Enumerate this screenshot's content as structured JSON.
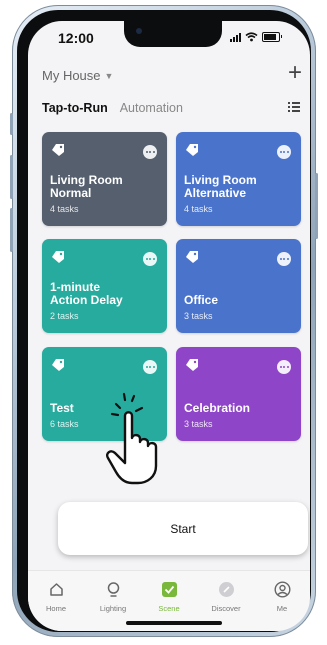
{
  "status": {
    "time": "12:00"
  },
  "header": {
    "house": "My House",
    "add_icon": "plus-icon"
  },
  "tabs": [
    {
      "label": "Tap-to-Run",
      "active": true
    },
    {
      "label": "Automation",
      "active": false
    }
  ],
  "scenes": [
    {
      "title_line1": "Living Room",
      "title_line2": "Normal",
      "tasks": "4 tasks",
      "color": "#555f6e",
      "dots": "#555f6e"
    },
    {
      "title_line1": "Living Room",
      "title_line2": "Alternative",
      "tasks": "4 tasks",
      "color": "#4a74cc",
      "dots": "#4a74cc"
    },
    {
      "title_line1": "1-minute",
      "title_line2": "Action Delay",
      "tasks": "2 tasks",
      "color": "#27ab9e",
      "dots": "#27ab9e"
    },
    {
      "title_line1": "",
      "title_line2": "Office",
      "tasks": "3 tasks",
      "color": "#4a74cc",
      "dots": "#4a74cc"
    },
    {
      "title_line1": "",
      "title_line2": "Test",
      "tasks": "6 tasks",
      "color": "#27ab9e",
      "dots": "#27ab9e"
    },
    {
      "title_line1": "",
      "title_line2": "Celebration",
      "tasks": "3 tasks",
      "color": "#8f45c8",
      "dots": "#8f45c8"
    }
  ],
  "start_button": "Start",
  "nav": [
    {
      "label": "Home",
      "icon": "home-icon",
      "active": false
    },
    {
      "label": "Lighting",
      "icon": "bulb-icon",
      "active": false
    },
    {
      "label": "Scene",
      "icon": "scene-icon",
      "active": true
    },
    {
      "label": "Discover",
      "icon": "discover-icon",
      "active": false
    },
    {
      "label": "Me",
      "icon": "user-icon",
      "active": false
    }
  ],
  "colors": {
    "accent": "#7ab83c"
  }
}
